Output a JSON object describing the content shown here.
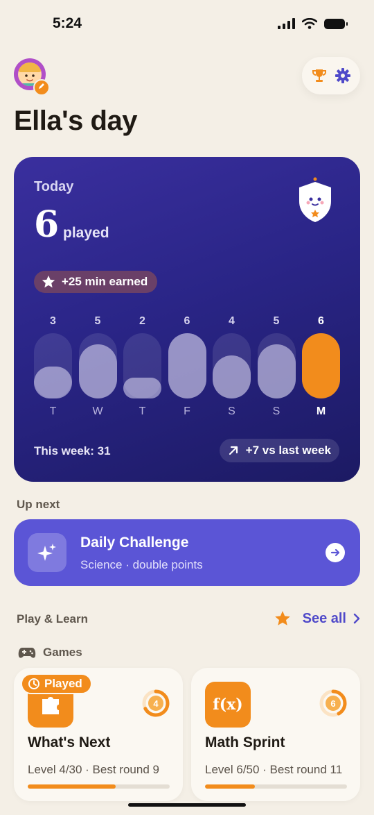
{
  "status_bar": {
    "time": "5:24",
    "signal_icon": "signal-bars-icon",
    "wifi_icon": "wifi-icon",
    "battery_icon": "battery-icon"
  },
  "header": {
    "title": "Ella's day",
    "avatar_icon": "child-avatar-icon",
    "avatar_edit_icon": "pencil-icon",
    "trophy_icon": "trophy-icon",
    "settings_icon": "gear-icon"
  },
  "today": {
    "label": "Today",
    "count": "6",
    "unit": "played",
    "mascot_icon": "shield-mascot-icon",
    "earned": {
      "icon": "star-icon",
      "text": "+25 min earned"
    },
    "week_total": "This week: 31",
    "delta": {
      "icon": "arrow-up-right-icon",
      "text": "+7 vs last week"
    }
  },
  "chart_data": {
    "type": "bar",
    "categories": [
      "T",
      "W",
      "T",
      "F",
      "S",
      "S",
      "M"
    ],
    "values": [
      3,
      5,
      2,
      6,
      4,
      5,
      6
    ],
    "ylim": [
      0,
      6
    ],
    "highlight_index": 6
  },
  "up_next": {
    "label": "Up next",
    "title": "Daily Challenge",
    "subtitle": "Science · double points",
    "icon": "sparkles-icon",
    "arrow_icon": "arrow-right-icon"
  },
  "play_learn": {
    "label": "Play & Learn",
    "star_icon": "star-icon",
    "see_all": "See all",
    "chevron_icon": "chevron-right-icon",
    "games_label": "Games",
    "games_icon": "gamepad-icon"
  },
  "games": [
    {
      "name": "What's Next",
      "level": "Level 4/30 · Best round 9",
      "ring_value": "4",
      "progress": 0.62,
      "badge": "Played",
      "badge_icon": "history-icon",
      "tile_icon": "puzzle-icon"
    },
    {
      "name": "Math Sprint",
      "level": "Level 6/50 · Best round 11",
      "ring_value": "6",
      "progress": 0.35,
      "tile_icon": "function-icon",
      "tile_text": "f(x)"
    }
  ],
  "colors": {
    "background": "#f4efe6",
    "card": "#2a2587",
    "accent": "#f28c1c",
    "challenge": "#5b55d6",
    "link": "#4f49c9"
  }
}
